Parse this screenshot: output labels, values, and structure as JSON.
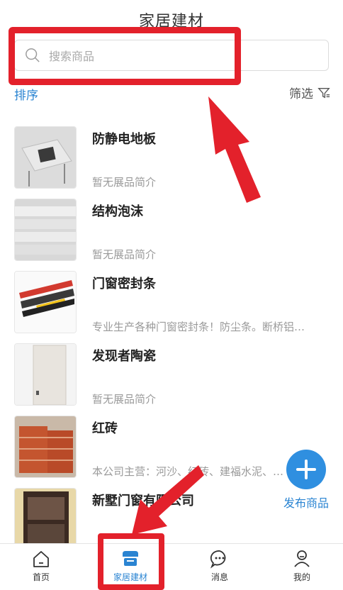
{
  "header": {
    "title": "家居建材"
  },
  "search": {
    "placeholder": "搜索商品"
  },
  "toolbar": {
    "sort_label": "排序",
    "filter_label": "筛选"
  },
  "products": [
    {
      "name": "防静电地板",
      "desc": "暂无展品简介"
    },
    {
      "name": "结构泡沫",
      "desc": "暂无展品简介"
    },
    {
      "name": "门窗密封条",
      "desc": "专业生产各种门窗密封条！防尘条。断桥铝…"
    },
    {
      "name": "发现者陶瓷",
      "desc": "暂无展品简介"
    },
    {
      "name": "红砖",
      "desc": "本公司主营：河沙、红砖、建福水泥、…"
    },
    {
      "name": "新墅门窗有限公司",
      "desc": ""
    }
  ],
  "fab": {
    "label": "发布商品"
  },
  "tabs": [
    {
      "label": "首页",
      "icon": "home-icon"
    },
    {
      "label": "家居建材",
      "icon": "store-icon"
    },
    {
      "label": "消息",
      "icon": "message-icon"
    },
    {
      "label": "我的",
      "icon": "user-icon"
    }
  ],
  "colors": {
    "accent": "#2a84d2",
    "annotation": "#e3212b",
    "fab": "#2f8fe0"
  }
}
